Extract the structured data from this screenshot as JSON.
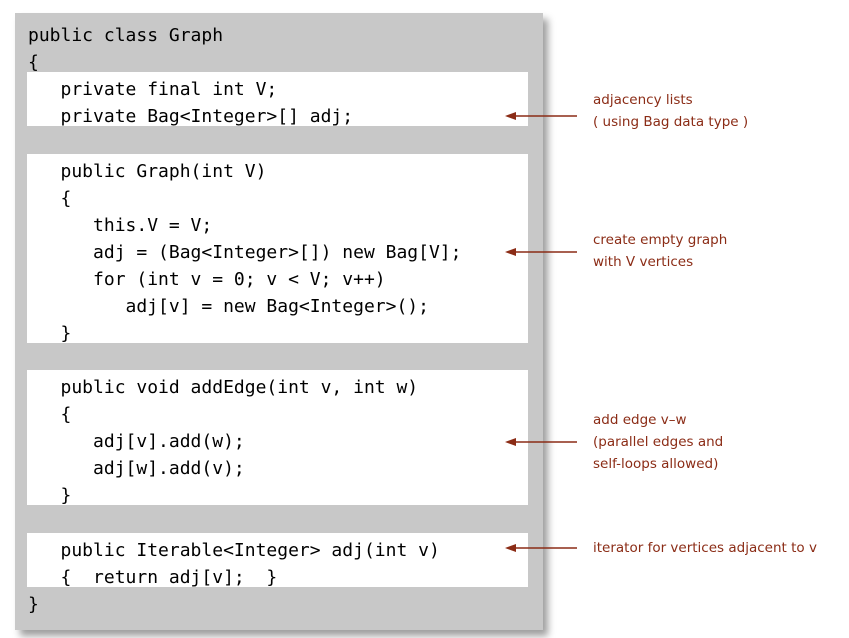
{
  "code": {
    "lines": [
      "public class Graph",
      "{",
      "   private final int V;",
      "   private Bag<Integer>[] adj;",
      "   public Graph(int V)",
      "   {",
      "      this.V = V;",
      "      adj = (Bag<Integer>[]) new Bag[V];",
      "      for (int v = 0; v < V; v++)",
      "         adj[v] = new Bag<Integer>();",
      "   }",
      "   public void addEdge(int v, int w)",
      "   {",
      "      adj[v].add(w);",
      "      adj[w].add(v);",
      "   }",
      "   public Iterable<Integer> adj(int v)",
      "   {  return adj[v];  }",
      "}"
    ]
  },
  "annotations": [
    {
      "lines": [
        "adjacency lists",
        "( using Bag data type )"
      ]
    },
    {
      "lines": [
        "create empty graph",
        "with V vertices"
      ]
    },
    {
      "lines": [
        "add edge v–w",
        "(parallel edges and",
        "self-loops allowed)"
      ]
    },
    {
      "lines": [
        "iterator for vertices adjacent to v"
      ]
    }
  ],
  "colors": {
    "annotation": "#8b2c16",
    "panel": "#c8c8c8",
    "block": "#ffffff"
  }
}
